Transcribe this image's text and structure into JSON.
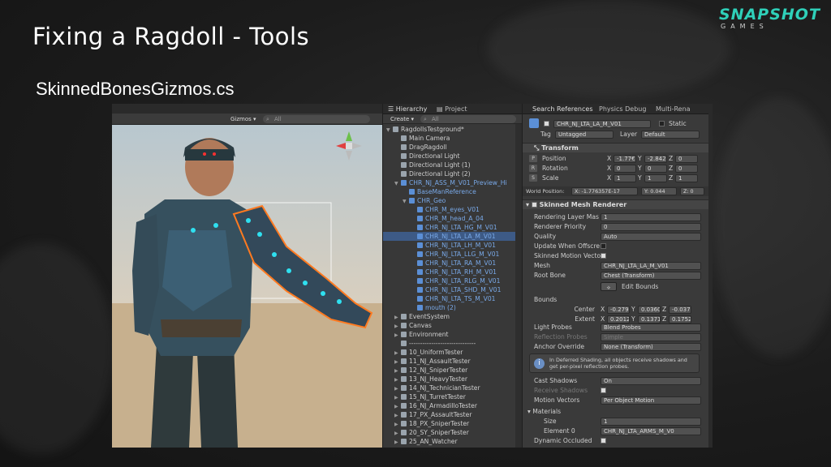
{
  "slide": {
    "title": "Fixing a Ragdoll - Tools",
    "subtitle": "SkinnedBonesGizmos.cs",
    "logo_main": "SNAPSHOT",
    "logo_sub": "GAMES"
  },
  "scene": {
    "gizmos_label": "Gizmos ▾",
    "search_placeholder": "All"
  },
  "hierarchy": {
    "tabs": [
      "Hierarchy",
      "Project"
    ],
    "create_label": "Create ▾",
    "search_placeholder": "All",
    "rows": [
      {
        "label": "RagdollsTestground*",
        "indent": 0,
        "expanded": true,
        "kind": "scene"
      },
      {
        "label": "Main Camera",
        "indent": 1
      },
      {
        "label": "DragRagdoll",
        "indent": 1
      },
      {
        "label": "Directional Light",
        "indent": 1
      },
      {
        "label": "Directional Light (1)",
        "indent": 1
      },
      {
        "label": "Directional Light (2)",
        "indent": 1
      },
      {
        "label": "CHR_NJ_ASS_M_V01_Preview_Hi",
        "indent": 1,
        "blue": true,
        "expanded": true
      },
      {
        "label": "BaseManReference",
        "indent": 2,
        "blue": true
      },
      {
        "label": "CHR_Geo",
        "indent": 2,
        "blue": true,
        "expanded": true
      },
      {
        "label": "CHR_M_eyes_V01",
        "indent": 3,
        "blue": true
      },
      {
        "label": "CHR_M_head_A_04",
        "indent": 3,
        "blue": true
      },
      {
        "label": "CHR_NJ_LTA_HG_M_V01",
        "indent": 3,
        "blue": true
      },
      {
        "label": "CHR_NJ_LTA_LA_M_V01",
        "indent": 3,
        "blue": true,
        "selected": true
      },
      {
        "label": "CHR_NJ_LTA_LH_M_V01",
        "indent": 3,
        "blue": true
      },
      {
        "label": "CHR_NJ_LTA_LLG_M_V01",
        "indent": 3,
        "blue": true
      },
      {
        "label": "CHR_NJ_LTA_RA_M_V01",
        "indent": 3,
        "blue": true
      },
      {
        "label": "CHR_NJ_LTA_RH_M_V01",
        "indent": 3,
        "blue": true
      },
      {
        "label": "CHR_NJ_LTA_RLG_M_V01",
        "indent": 3,
        "blue": true
      },
      {
        "label": "CHR_NJ_LTA_SHD_M_V01",
        "indent": 3,
        "blue": true
      },
      {
        "label": "CHR_NJ_LTA_TS_M_V01",
        "indent": 3,
        "blue": true
      },
      {
        "label": "mouth (2)",
        "indent": 3,
        "blue": true
      },
      {
        "label": "EventSystem",
        "indent": 1,
        "collapsed": true
      },
      {
        "label": "Canvas",
        "indent": 1,
        "collapsed": true
      },
      {
        "label": "Environment",
        "indent": 1,
        "collapsed": true
      },
      {
        "label": "------------------------------",
        "indent": 1
      },
      {
        "label": "10_UniformTester",
        "indent": 1,
        "collapsed": true
      },
      {
        "label": "11_NJ_AssaultTester",
        "indent": 1,
        "collapsed": true
      },
      {
        "label": "12_NJ_SniperTester",
        "indent": 1,
        "collapsed": true
      },
      {
        "label": "13_NJ_HeavyTester",
        "indent": 1,
        "collapsed": true
      },
      {
        "label": "14_NJ_TechnicianTester",
        "indent": 1,
        "collapsed": true
      },
      {
        "label": "15_NJ_TurretTester",
        "indent": 1,
        "collapsed": true
      },
      {
        "label": "16_NJ_ArmadilloTester",
        "indent": 1,
        "collapsed": true
      },
      {
        "label": "17_PX_AssaultTester",
        "indent": 1,
        "collapsed": true
      },
      {
        "label": "18_PX_SniperTester",
        "indent": 1,
        "collapsed": true
      },
      {
        "label": "20_SY_SniperTester",
        "indent": 1,
        "collapsed": true
      },
      {
        "label": "25_AN_Watcher",
        "indent": 1,
        "collapsed": true
      }
    ]
  },
  "inspector": {
    "tabs": [
      "Search References",
      "Physics Debug",
      "Multi-Rena"
    ],
    "object_name": "CHR_NJ_LTA_LA_M_V01",
    "static_label": "Static",
    "tag_label": "Tag",
    "tag_value": "Untagged",
    "layer_label": "Layer",
    "layer_value": "Default",
    "transform": {
      "title": "Transform",
      "position": {
        "label": "Position",
        "x": "-1.77€",
        "y": "-2.842",
        "z": "0"
      },
      "rotation": {
        "label": "Rotation",
        "x": "0",
        "y": "0",
        "z": "0"
      },
      "scale": {
        "label": "Scale",
        "x": "1",
        "y": "1",
        "z": "1"
      },
      "world_label": "World Position:",
      "world_x": "X: -1.776357E-17",
      "world_y": "Y: 0.044",
      "world_z": "Z: 0"
    },
    "smr": {
      "title": "Skinned Mesh Renderer",
      "rows": [
        {
          "label": "Rendering Layer Mas",
          "value": "1"
        },
        {
          "label": "Renderer Priority",
          "value": "0"
        },
        {
          "label": "Quality",
          "value": "Auto"
        },
        {
          "label": "Update When Offscre",
          "check": false
        },
        {
          "label": "Skinned Motion Vecto",
          "check": true
        },
        {
          "label": "Mesh",
          "value": "CHR_NJ_LTA_LA_M_V01"
        },
        {
          "label": "Root Bone",
          "value": "Chest (Transform)"
        }
      ],
      "edit_bounds": "Edit Bounds",
      "bounds_label": "Bounds",
      "center": {
        "label": "Center",
        "x": "-0.2795",
        "y": "0.0360",
        "z": "-0.037("
      },
      "extent": {
        "label": "Extent",
        "x": "0.2012",
        "y": "0.1371",
        "z": "0.1752"
      },
      "light_probes": {
        "label": "Light Probes",
        "value": "Blend Probes"
      },
      "reflection_probes": {
        "label": "Reflection Probes",
        "value": "Simple"
      },
      "anchor_override": {
        "label": "Anchor Override",
        "value": "None (Transform)"
      },
      "help_text": "In Deferred Shading, all objects receive shadows and get per-pixel reflection probes.",
      "cast_shadows": {
        "label": "Cast Shadows",
        "value": "On"
      },
      "receive_shadows": {
        "label": "Receive Shadows"
      },
      "motion_vectors": {
        "label": "Motion Vectors",
        "value": "Per Object Motion"
      },
      "materials_label": "Materials",
      "size": {
        "label": "Size",
        "value": "1"
      },
      "element0": {
        "label": "Element 0",
        "value": "CHR_NJ_LTA_ARMS_M_V0"
      },
      "dynamic_occluded": {
        "label": "Dynamic Occluded"
      }
    }
  }
}
